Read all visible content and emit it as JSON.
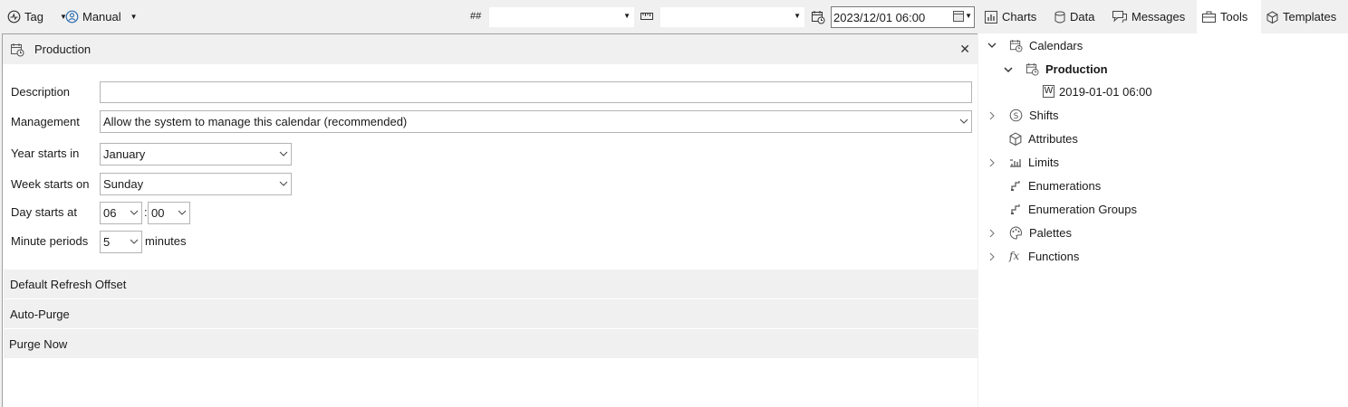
{
  "toolbar": {
    "tag_label": "Tag",
    "manual_label": "Manual",
    "hash_label": "##",
    "date_value": "2023/12/01 06:00"
  },
  "tabs": [
    {
      "label": "Charts",
      "icon": "bar-chart-icon"
    },
    {
      "label": "Data",
      "icon": "database-icon"
    },
    {
      "label": "Messages",
      "icon": "messages-icon"
    },
    {
      "label": "Tools",
      "icon": "toolbox-icon",
      "active": true
    },
    {
      "label": "Templates",
      "icon": "cube-icon"
    }
  ],
  "panel": {
    "title": "Production",
    "form": {
      "description_label": "Description",
      "description_value": "",
      "management_label": "Management",
      "management_value": "Allow the system to manage this calendar (recommended)",
      "year_label": "Year starts in",
      "year_value": "January",
      "week_label": "Week starts on",
      "week_value": "Sunday",
      "day_label": "Day starts at",
      "day_hour": "06",
      "day_sep": ":",
      "day_minute": "00",
      "minute_label": "Minute periods",
      "minute_value": "5",
      "minute_unit": "minutes"
    },
    "sections": [
      "Default Refresh Offset",
      "Auto-Purge",
      "Purge Now"
    ]
  },
  "tree": {
    "calendars": "Calendars",
    "production": "Production",
    "week_entry_badge": "W",
    "week_entry": "2019-01-01 06:00",
    "shifts": "Shifts",
    "attributes": "Attributes",
    "limits": "Limits",
    "enumerations": "Enumerations",
    "enumeration_groups": "Enumeration Groups",
    "palettes": "Palettes",
    "functions": "Functions"
  }
}
